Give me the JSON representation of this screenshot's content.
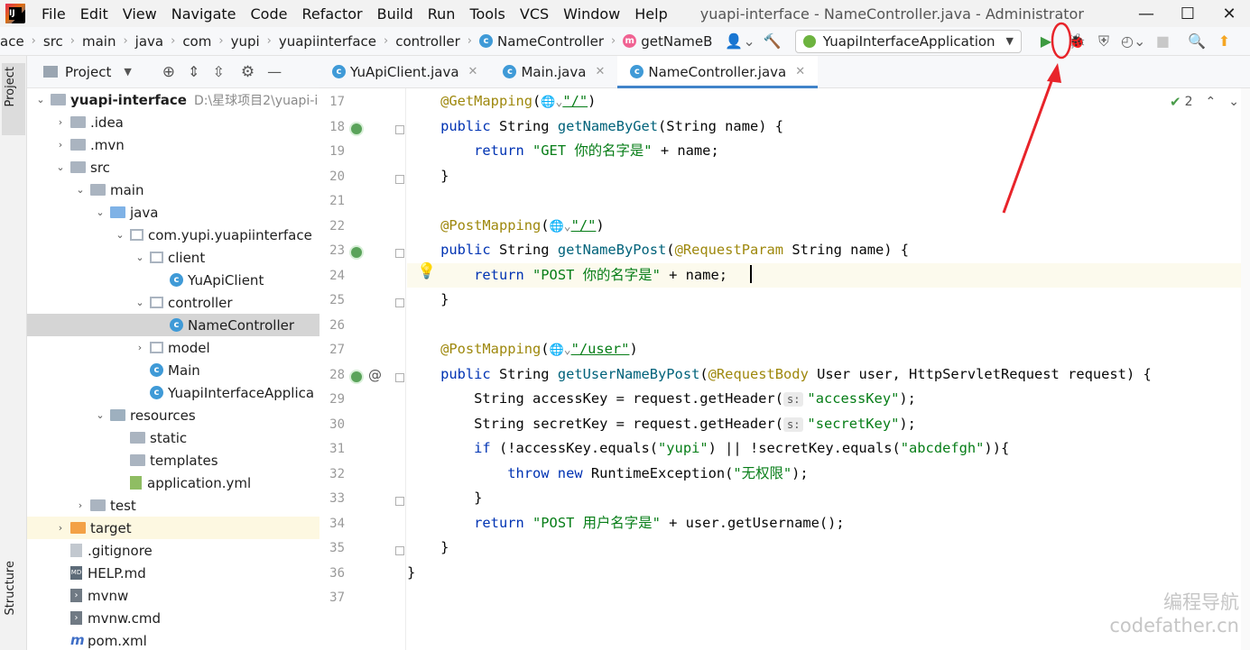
{
  "menubar": {
    "logo": "IJ",
    "items": [
      "File",
      "Edit",
      "View",
      "Navigate",
      "Code",
      "Refactor",
      "Build",
      "Run",
      "Tools",
      "VCS",
      "Window",
      "Help"
    ],
    "window_title": "yuapi-interface - NameController.java - Administrator",
    "controls": {
      "minimize": "—",
      "maximize": "☐",
      "close": "✕"
    }
  },
  "navbar": {
    "breadcrumbs": [
      "ace",
      "src",
      "main",
      "java",
      "com",
      "yupi",
      "yuapiinterface",
      "controller",
      "NameController",
      "getNameB"
    ],
    "run_config": "YuapiInterfaceApplication"
  },
  "left_strip": {
    "project_tab": "Project",
    "structure_tab": "Structure"
  },
  "project_panel": {
    "title": "Project",
    "tree": [
      {
        "label": "yuapi-interface",
        "extra": "D:\\星球项目2\\yuapi-i",
        "depth": 0,
        "twisty": "down",
        "icon": "module",
        "bold": true
      },
      {
        "label": ".idea",
        "depth": 1,
        "twisty": "right",
        "icon": "folder"
      },
      {
        "label": ".mvn",
        "depth": 1,
        "twisty": "right",
        "icon": "folder"
      },
      {
        "label": "src",
        "depth": 1,
        "twisty": "down",
        "icon": "folder"
      },
      {
        "label": "main",
        "depth": 2,
        "twisty": "down",
        "icon": "folder"
      },
      {
        "label": "java",
        "depth": 3,
        "twisty": "down",
        "icon": "src"
      },
      {
        "label": "com.yupi.yuapiinterface",
        "depth": 4,
        "twisty": "down",
        "icon": "pkg"
      },
      {
        "label": "client",
        "depth": 5,
        "twisty": "down",
        "icon": "pkg"
      },
      {
        "label": "YuApiClient",
        "depth": 6,
        "twisty": "none",
        "icon": "class"
      },
      {
        "label": "controller",
        "depth": 5,
        "twisty": "down",
        "icon": "pkg"
      },
      {
        "label": "NameController",
        "depth": 6,
        "twisty": "none",
        "icon": "class",
        "selected": true
      },
      {
        "label": "model",
        "depth": 5,
        "twisty": "right",
        "icon": "pkg"
      },
      {
        "label": "Main",
        "depth": 5,
        "twisty": "none",
        "icon": "class"
      },
      {
        "label": "YuapiInterfaceApplica",
        "depth": 5,
        "twisty": "none",
        "icon": "class"
      },
      {
        "label": "resources",
        "depth": 3,
        "twisty": "down",
        "icon": "res"
      },
      {
        "label": "static",
        "depth": 4,
        "twisty": "none",
        "icon": "folder"
      },
      {
        "label": "templates",
        "depth": 4,
        "twisty": "none",
        "icon": "folder"
      },
      {
        "label": "application.yml",
        "depth": 4,
        "twisty": "none",
        "icon": "yml"
      },
      {
        "label": "test",
        "depth": 2,
        "twisty": "right",
        "icon": "folder"
      },
      {
        "label": "target",
        "depth": 1,
        "twisty": "right",
        "icon": "target",
        "highlight": true
      },
      {
        "label": ".gitignore",
        "depth": 1,
        "twisty": "none",
        "icon": "file"
      },
      {
        "label": "HELP.md",
        "depth": 1,
        "twisty": "none",
        "icon": "md"
      },
      {
        "label": "mvnw",
        "depth": 1,
        "twisty": "none",
        "icon": "term"
      },
      {
        "label": "mvnw.cmd",
        "depth": 1,
        "twisty": "none",
        "icon": "term"
      },
      {
        "label": "pom.xml",
        "depth": 1,
        "twisty": "none",
        "icon": "pom"
      }
    ]
  },
  "editor": {
    "tabs": [
      {
        "label": "YuApiClient.java",
        "active": false
      },
      {
        "label": "Main.java",
        "active": false
      },
      {
        "label": "NameController.java",
        "active": true
      }
    ],
    "line_numbers": [
      "17",
      "18",
      "19",
      "20",
      "21",
      "22",
      "23",
      "24",
      "25",
      "26",
      "27",
      "28",
      "29",
      "30",
      "31",
      "32",
      "33",
      "34",
      "35",
      "36",
      "37"
    ],
    "inspection_count": "2",
    "hint_label": "s:",
    "lines": [
      [
        {
          "t": "    "
        },
        {
          "t": "@GetMapping",
          "c": "ann"
        },
        {
          "t": "("
        },
        {
          "t": "🌐⌄",
          "c": "globe"
        },
        {
          "t": "\"/\"",
          "c": "str ul"
        },
        {
          "t": ")"
        }
      ],
      [
        {
          "t": "    "
        },
        {
          "t": "public ",
          "c": "kw"
        },
        {
          "t": "String "
        },
        {
          "t": "getNameByGet",
          "c": "fn"
        },
        {
          "t": "(String name) {"
        }
      ],
      [
        {
          "t": "        "
        },
        {
          "t": "return ",
          "c": "kw"
        },
        {
          "t": "\"GET 你的名字是\"",
          "c": "str"
        },
        {
          "t": " + name;"
        }
      ],
      [
        {
          "t": "    }"
        }
      ],
      [
        {
          "t": ""
        }
      ],
      [
        {
          "t": "    "
        },
        {
          "t": "@PostMapping",
          "c": "ann"
        },
        {
          "t": "("
        },
        {
          "t": "🌐⌄",
          "c": "globe"
        },
        {
          "t": "\"/\"",
          "c": "str ul"
        },
        {
          "t": ")"
        }
      ],
      [
        {
          "t": "    "
        },
        {
          "t": "public ",
          "c": "kw"
        },
        {
          "t": "String "
        },
        {
          "t": "getNameByPost",
          "c": "fn"
        },
        {
          "t": "("
        },
        {
          "t": "@RequestParam",
          "c": "ann"
        },
        {
          "t": " String name) {"
        }
      ],
      [
        {
          "t": "        "
        },
        {
          "t": "return ",
          "c": "kw"
        },
        {
          "t": "\"POST 你的名字是\"",
          "c": "str"
        },
        {
          "t": " + name;"
        }
      ],
      [
        {
          "t": "    }"
        }
      ],
      [
        {
          "t": ""
        }
      ],
      [
        {
          "t": "    "
        },
        {
          "t": "@PostMapping",
          "c": "ann"
        },
        {
          "t": "("
        },
        {
          "t": "🌐⌄",
          "c": "globe"
        },
        {
          "t": "\"/user\"",
          "c": "str ul"
        },
        {
          "t": ")"
        }
      ],
      [
        {
          "t": "    "
        },
        {
          "t": "public ",
          "c": "kw"
        },
        {
          "t": "String "
        },
        {
          "t": "getUserNameByPost",
          "c": "fn"
        },
        {
          "t": "("
        },
        {
          "t": "@RequestBody",
          "c": "ann"
        },
        {
          "t": " User user, HttpServletRequest request) {"
        }
      ],
      [
        {
          "t": "        String accessKey = request.getHeader("
        },
        {
          "t": "s:",
          "c": "hint"
        },
        {
          "t": "\"accessKey\"",
          "c": "str"
        },
        {
          "t": ");"
        }
      ],
      [
        {
          "t": "        String secretKey = request.getHeader("
        },
        {
          "t": "s:",
          "c": "hint"
        },
        {
          "t": "\"secretKey\"",
          "c": "str"
        },
        {
          "t": ");"
        }
      ],
      [
        {
          "t": "        "
        },
        {
          "t": "if ",
          "c": "kw"
        },
        {
          "t": "(!accessKey.equals("
        },
        {
          "t": "\"yupi\"",
          "c": "str"
        },
        {
          "t": ") || !secretKey.equals("
        },
        {
          "t": "\"abcdefgh\"",
          "c": "str"
        },
        {
          "t": ")){"
        }
      ],
      [
        {
          "t": "            "
        },
        {
          "t": "throw new ",
          "c": "kw"
        },
        {
          "t": "RuntimeException("
        },
        {
          "t": "\"无权限\"",
          "c": "str"
        },
        {
          "t": ");"
        }
      ],
      [
        {
          "t": "        }"
        }
      ],
      [
        {
          "t": "        "
        },
        {
          "t": "return ",
          "c": "kw"
        },
        {
          "t": "\"POST 用户名字是\"",
          "c": "str"
        },
        {
          "t": " + user.getUsername();"
        }
      ],
      [
        {
          "t": "    }"
        }
      ],
      [
        {
          "t": "}"
        }
      ],
      [
        {
          "t": ""
        }
      ]
    ]
  },
  "watermark": {
    "line1": "编程导航",
    "line2": "codefather.cn"
  },
  "colors": {
    "annotation_red": "#e8242a",
    "accent_blue": "#4083c9",
    "run_green": "#3d9a40",
    "debug_green": "#59a869"
  }
}
